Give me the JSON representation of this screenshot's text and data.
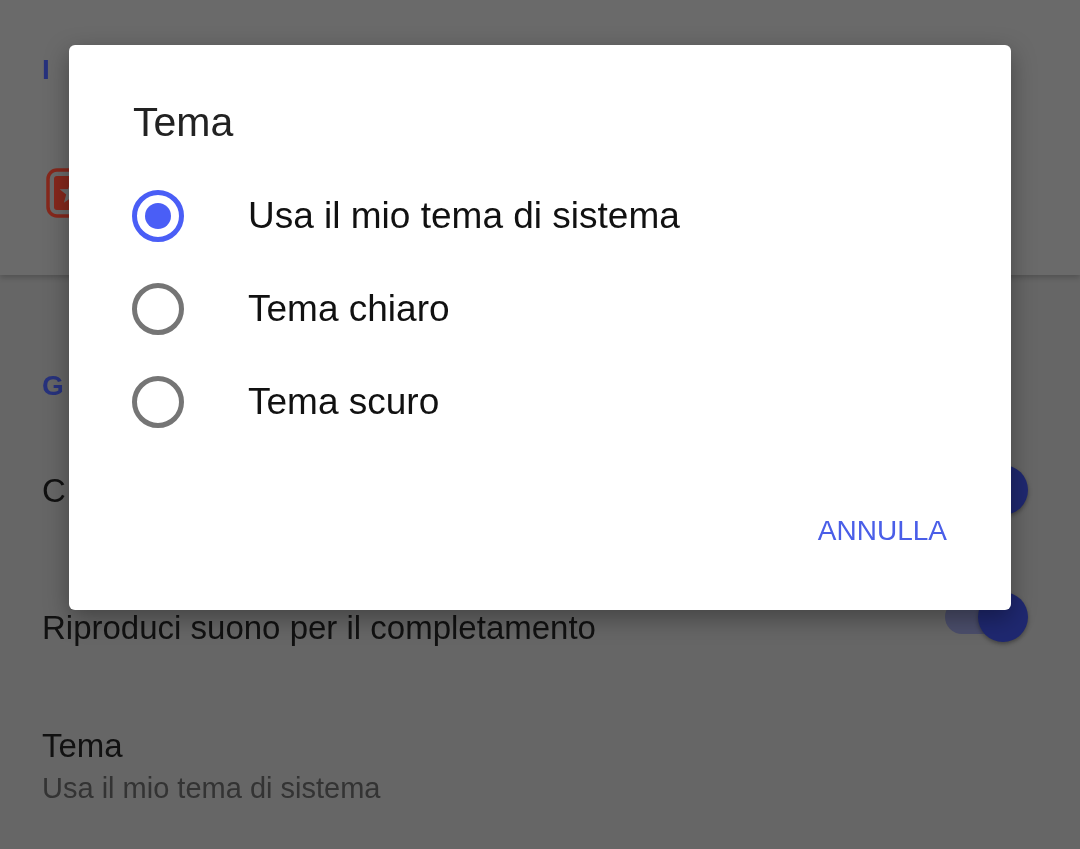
{
  "settings": {
    "sections": [
      {
        "header": "I",
        "rows": [
          {
            "kind": "icon"
          }
        ]
      },
      {
        "header": "G",
        "rows": [
          {
            "kind": "toggle",
            "label": "C",
            "on": true
          },
          {
            "kind": "toggle",
            "label": "Riproduci suono per il completamento",
            "on": true
          },
          {
            "kind": "text",
            "label": "Tema",
            "summary": "Usa il mio tema di sistema"
          }
        ]
      }
    ]
  },
  "dialog": {
    "title": "Tema",
    "options": [
      {
        "label": "Usa il mio tema di sistema",
        "selected": true
      },
      {
        "label": "Tema chiaro",
        "selected": false
      },
      {
        "label": "Tema scuro",
        "selected": false
      }
    ],
    "buttons": [
      "ANNULLA"
    ]
  }
}
